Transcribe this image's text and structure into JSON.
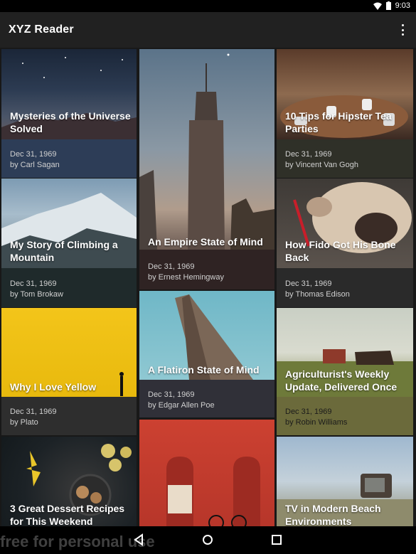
{
  "status_bar": {
    "time": "9:03",
    "icons": [
      "wifi-icon",
      "battery-icon"
    ]
  },
  "app_bar": {
    "title": "XYZ Reader",
    "menu_icon": "more-vert-icon"
  },
  "articles": [
    {
      "title": "Mysteries of the Universe Solved",
      "date": "Dec 31, 1969",
      "author": "by Carl Sagan"
    },
    {
      "title": "My Story of Climbing a Mountain",
      "date": "Dec 31, 1969",
      "author": "by Tom Brokaw"
    },
    {
      "title": "Why I Love Yellow",
      "date": "Dec 31, 1969",
      "author": "by Plato"
    },
    {
      "title": "3 Great Dessert Recipes for This Weekend",
      "date": "",
      "author": ""
    },
    {
      "title": "An Empire State of Mind",
      "date": "Dec 31, 1969",
      "author": "by Ernest Hemingway"
    },
    {
      "title": "A Flatiron State of Mind",
      "date": "Dec 31, 1969",
      "author": "by Edgar Allen Poe"
    },
    {
      "title": "",
      "date": "",
      "author": ""
    },
    {
      "title": "10 Tips for Hipster Tea Parties",
      "date": "Dec 31, 1969",
      "author": "by Vincent Van Gogh"
    },
    {
      "title": "How Fido Got His Bone Back",
      "date": "Dec 31, 1969",
      "author": "by Thomas Edison"
    },
    {
      "title": "Agriculturist's Weekly Update, Delivered Once",
      "date": "Dec 31, 1969",
      "author": "by Robin Williams"
    },
    {
      "title": "TV in Modern Beach Environments",
      "date": "",
      "author": ""
    }
  ],
  "nav_bar": {
    "buttons": [
      "back-icon",
      "home-icon",
      "recents-icon"
    ]
  },
  "watermark": "free for personal use"
}
